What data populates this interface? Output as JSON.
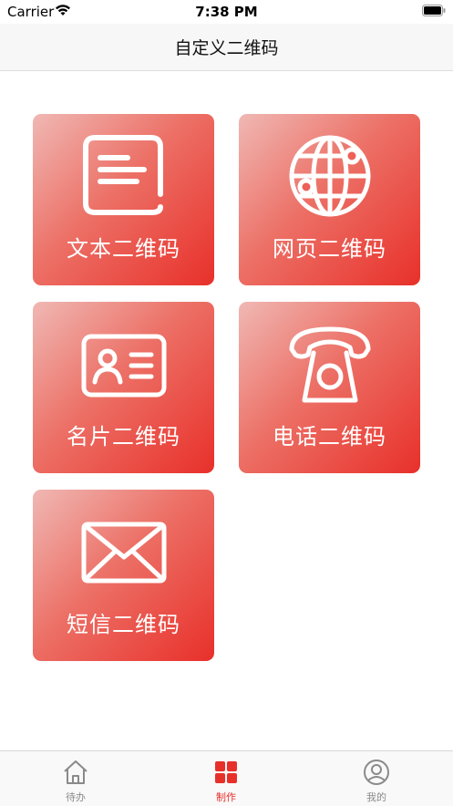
{
  "status_bar": {
    "carrier": "Carrier",
    "time": "7:38 PM"
  },
  "nav": {
    "title": "自定义二维码"
  },
  "cards": [
    {
      "label": "文本二维码",
      "icon": "text-document-icon"
    },
    {
      "label": "网页二维码",
      "icon": "globe-icon"
    },
    {
      "label": "名片二维码",
      "icon": "business-card-icon"
    },
    {
      "label": "电话二维码",
      "icon": "telephone-icon"
    },
    {
      "label": "短信二维码",
      "icon": "envelope-icon"
    }
  ],
  "tabs": [
    {
      "label": "待办",
      "icon": "home-icon",
      "active": false
    },
    {
      "label": "制作",
      "icon": "grid-icon",
      "active": true
    },
    {
      "label": "我的",
      "icon": "user-icon",
      "active": false
    }
  ],
  "colors": {
    "accent": "#e8302a",
    "tab_inactive": "#8a8a8a",
    "card_gradient_start": "#f0b8b4",
    "card_gradient_end": "#e8302a"
  }
}
